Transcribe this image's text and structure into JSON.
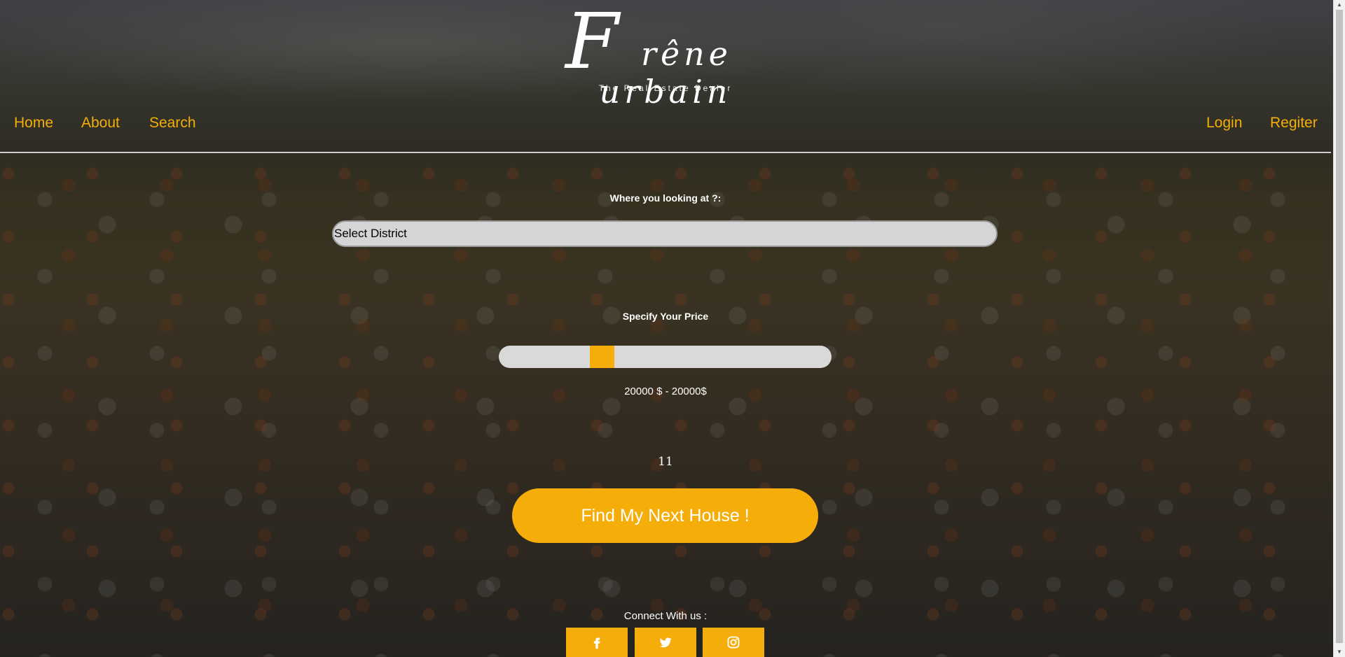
{
  "brand": {
    "logo_initial": "F",
    "logo_text": "rêne  urbain",
    "tagline": "The Real Estate Dealer"
  },
  "nav": {
    "home": "Home",
    "about": "About",
    "search": "Search",
    "login": "Login",
    "register": "Regiter"
  },
  "search": {
    "where_label": "Where you looking at ?:",
    "district_select": "Select District",
    "price_label": "Specify Your Price",
    "price_range_text": "20000 $ - 20000$",
    "slider_min_fraction": 0.28,
    "slider_max_fraction": 0.34,
    "count_text": "11",
    "submit_label": "Find My Next House !"
  },
  "footer": {
    "connect_label": "Connect With us :",
    "social": [
      "facebook-icon",
      "twitter-icon",
      "instagram-icon"
    ]
  },
  "colors": {
    "accent": "#f5ae09"
  }
}
